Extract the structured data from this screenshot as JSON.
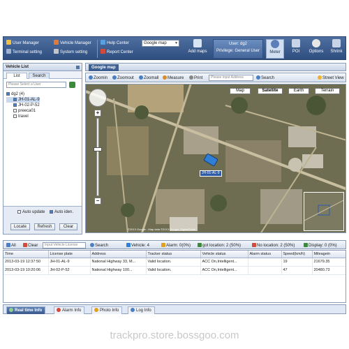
{
  "toolbar": {
    "user_manager": "User Manager",
    "vehicle_manager": "Vehicle Manager",
    "terminal_setting": "Terminal setting",
    "system_setting": "System setting",
    "help_center": "Help Center",
    "report_center": "Report Center",
    "map_select": "Google map",
    "add_maps": "Add maps",
    "user_line1": "User: dg2",
    "user_line2": "Privilege: General User",
    "meter": "Meter",
    "poi": "POI",
    "options": "Options",
    "shrink": "Shrink"
  },
  "vehicle_list": {
    "title": "Vehicle List",
    "tab_list": "List",
    "tab_search": "Search",
    "user_placeholder": "Please Select a User",
    "tree": [
      {
        "label": "dg2 (4)",
        "level": 0,
        "checked": true
      },
      {
        "label": "JH-01-AL-9",
        "level": 1,
        "checked": true,
        "selected": true
      },
      {
        "label": "JH-02-P-52",
        "level": 1,
        "checked": true
      },
      {
        "label": "preeca01",
        "level": 1,
        "checked": false
      },
      {
        "label": "travel",
        "level": 1,
        "checked": false
      }
    ],
    "auto_update": "Auto update",
    "auto_ident": "Auto iden.",
    "locate": "Locate",
    "refresh": "Refresh",
    "clear": "Clear"
  },
  "map": {
    "tab_title": "Google map",
    "tools": [
      "Zoomin",
      "Zoomout",
      "Zoomall",
      "Measure",
      "Print"
    ],
    "address_placeholder": "Please input Address",
    "search": "Search",
    "street_view": "Street View",
    "map_types": [
      "Map",
      "Satellite",
      "Earth",
      "Terrain"
    ],
    "active_type": "Satellite",
    "vehicle_label": "JH-01-AL-9",
    "copyright": "©2013 Google - Map data ©2013 Google, DigitalGlobe"
  },
  "bottom_toolbar": {
    "all": "All",
    "clear": "Clear",
    "input_placeholder": "Input Vehicle License",
    "search": "Search",
    "vehicles": "Vehicle: 4",
    "alarm": "Alarm: 0(0%)",
    "got_location": "got location: 2 (50%)",
    "no_location": "No location: 2 (50%)",
    "display": "Display: 0 (0%)"
  },
  "table": {
    "columns": [
      "Time",
      "License plate",
      "Address",
      "Tracker status",
      "Vehicle status",
      "Alarm status",
      "Speed(km/h)",
      "Mileagein"
    ],
    "rows": [
      [
        "2013-03-19 12:37:50",
        "JH-01-AL-9",
        "National Highway 33, M...",
        "Valid location.",
        "ACC On,Intelligent...",
        "",
        "19",
        "21679.35"
      ],
      [
        "2013-03-19 10:20:06",
        "JH-02-P-52",
        "National Highway 100...",
        "Valid location.",
        "ACC On,Intelligent...",
        "",
        "47",
        "20480.73"
      ]
    ]
  },
  "bottom_tabs": [
    "Real time Info",
    "Alarm Info",
    "Photo Info",
    "Log Info"
  ],
  "watermark": "trackpro.store.bossgoo.com",
  "colors": {
    "toolbar_bg": "#3d5f92",
    "accent": "#2c5ba8",
    "panel_border": "#8a9bb5"
  }
}
